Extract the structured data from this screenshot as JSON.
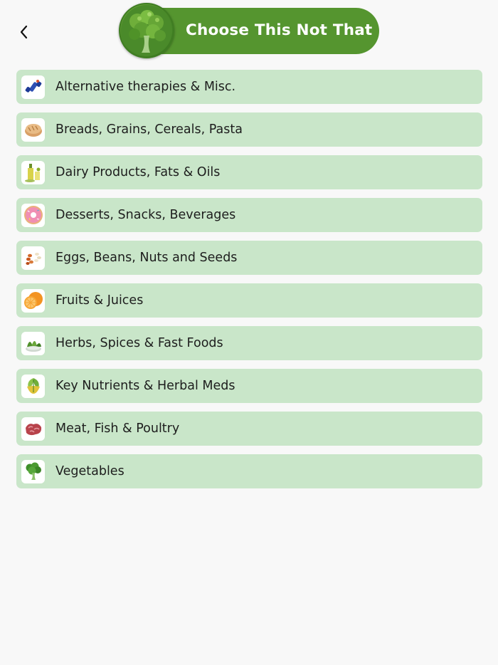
{
  "header": {
    "title": "Choose This Not That",
    "back_icon": "chevron-left-icon",
    "logo_icon": "broccoli-icon"
  },
  "categories": [
    {
      "label": "Alternative therapies & Misc.",
      "icon": "dumbbell-icon"
    },
    {
      "label": "Breads, Grains, Cereals, Pasta",
      "icon": "bread-icon"
    },
    {
      "label": "Dairy Products, Fats & Oils",
      "icon": "oil-bottle-icon"
    },
    {
      "label": "Desserts, Snacks, Beverages",
      "icon": "donut-icon"
    },
    {
      "label": "Eggs, Beans, Nuts and Seeds",
      "icon": "beans-icon"
    },
    {
      "label": "Fruits & Juices",
      "icon": "orange-icon"
    },
    {
      "label": "Herbs, Spices & Fast Foods",
      "icon": "herbs-icon"
    },
    {
      "label": "Key Nutrients & Herbal Meds",
      "icon": "herbal-leaf-icon"
    },
    {
      "label": "Meat, Fish & Poultry",
      "icon": "meat-icon"
    },
    {
      "label": "Vegetables",
      "icon": "broccoli-icon"
    }
  ],
  "colors": {
    "header_green": "#55952f",
    "item_background": "#c9e6c9",
    "page_background": "#f8f8f8"
  }
}
